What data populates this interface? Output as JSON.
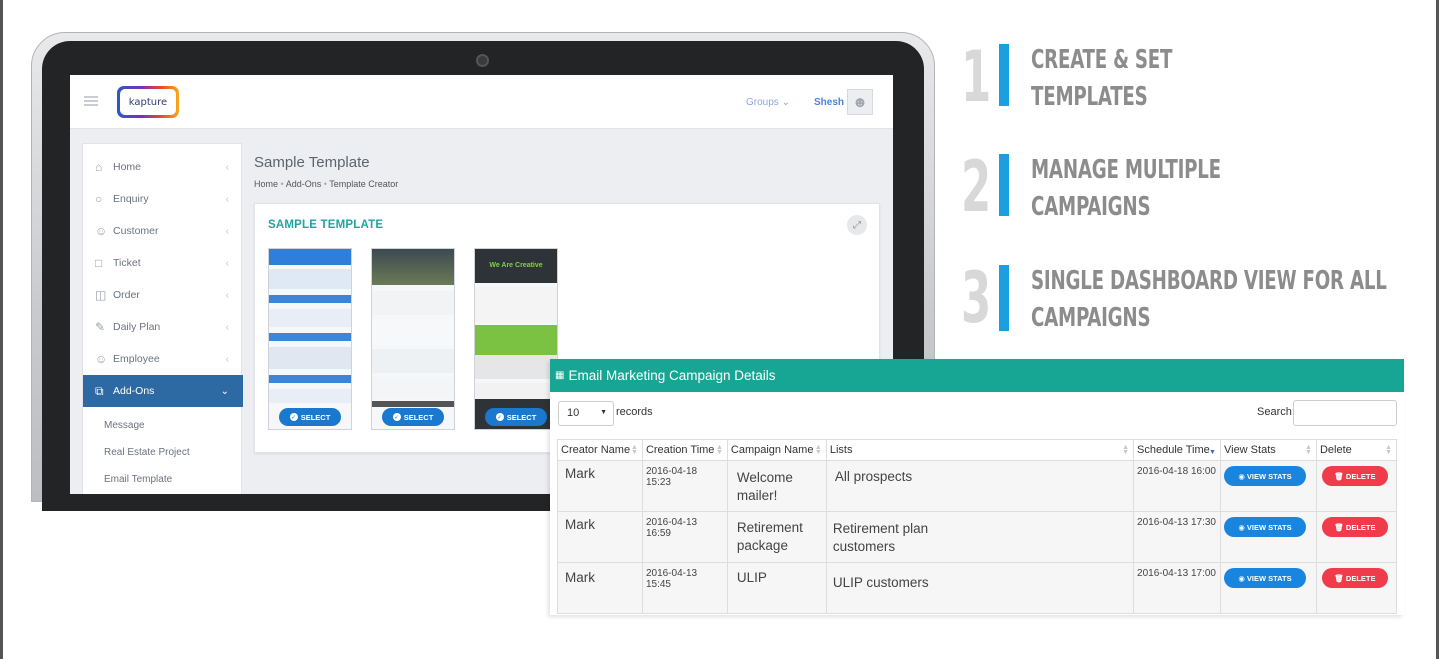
{
  "features": [
    {
      "num": "1",
      "lines": [
        "CREATE & SET",
        "TEMPLATES"
      ]
    },
    {
      "num": "2",
      "lines": [
        "MANAGE MULTIPLE",
        "CAMPAIGNS"
      ]
    },
    {
      "num": "3",
      "lines": [
        "SINGLE  DASHBOARD VIEW FOR ALL",
        "CAMPAIGNS"
      ]
    }
  ],
  "app": {
    "logo_text": "kapture",
    "groups_label": "Groups",
    "user_name": "Shesh"
  },
  "sidebar": {
    "items": [
      {
        "label": "Home",
        "icon": "home-icon"
      },
      {
        "label": "Enquiry",
        "icon": "enquiry-icon"
      },
      {
        "label": "Customer",
        "icon": "customer-icon"
      },
      {
        "label": "Ticket",
        "icon": "ticket-icon"
      },
      {
        "label": "Order",
        "icon": "order-icon"
      },
      {
        "label": "Daily Plan",
        "icon": "daily-plan-icon"
      },
      {
        "label": "Employee",
        "icon": "employee-icon"
      },
      {
        "label": "Add-Ons",
        "icon": "add-ons-icon"
      }
    ],
    "sub_items": [
      "Message",
      "Real Estate Project",
      "Email Template"
    ]
  },
  "content": {
    "title": "Sample Template",
    "breadcrumb": [
      "Home",
      "Add-Ons",
      "Template Creator"
    ],
    "card_title": "SAMPLE TEMPLATE",
    "select_label": "SELECT",
    "thumb3_heading": "We Are Creative"
  },
  "panel": {
    "title": "Email Marketing Campaign Details",
    "records_value": "10",
    "records_label": "records",
    "search_label": "Search:",
    "columns": [
      "Creator Name",
      "Creation Time",
      "Campaign Name",
      "Lists",
      "Schedule Time",
      "View Stats",
      "Delete"
    ],
    "rows": [
      {
        "creator": "Mark",
        "created": "2016-04-18 15:23",
        "campaign": [
          "Welcome",
          "mailer!"
        ],
        "lists": [
          "All prospects"
        ],
        "schedule": "2016-04-18 16:00"
      },
      {
        "creator": "Mark",
        "created": "2016-04-13 16:59",
        "campaign": [
          "Retirement",
          "package"
        ],
        "lists": [
          "Retirement plan",
          "customers"
        ],
        "schedule": "2016-04-13 17:30"
      },
      {
        "creator": "Mark",
        "created": "2016-04-13 15:45",
        "campaign": [
          "ULIP"
        ],
        "lists": [
          "ULIP customers"
        ],
        "schedule": "2016-04-13 17:00"
      }
    ],
    "view_stats_label": "VIEW STATS",
    "delete_label": "DELETE"
  },
  "colors": {
    "teal": "#17a594",
    "accent_blue": "#1a9fe0",
    "delete_red": "#ef3b4a",
    "sidebar_active": "#2d6aa4"
  }
}
